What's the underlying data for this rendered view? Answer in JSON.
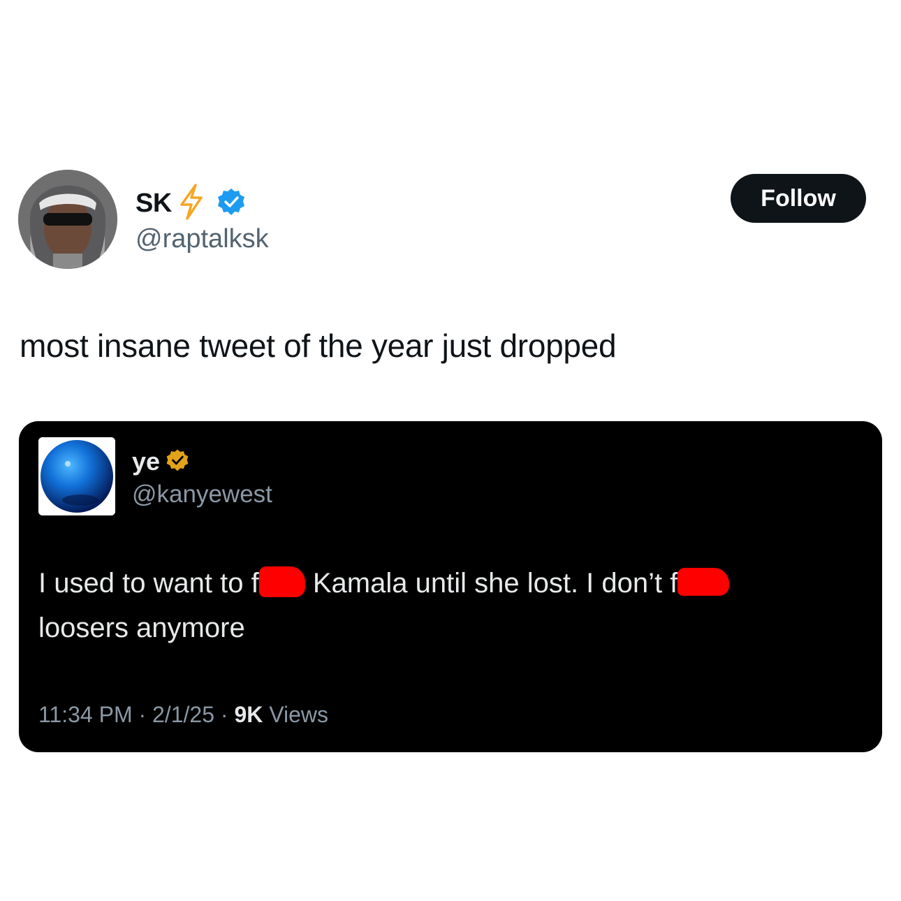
{
  "author": {
    "display_name": "SK",
    "handle": "@raptalksk",
    "follow_label": "Follow"
  },
  "post": {
    "text": "most insane tweet of the year just dropped"
  },
  "quoted": {
    "display_name": "ye",
    "handle": "@kanyewest",
    "text_part1": "I used to want to f",
    "text_part2": " Kamala until she lost. I don’t f",
    "text_part3": "loosers anymore",
    "time": "11:34 PM",
    "date": "2/1/25",
    "views_count": "9K",
    "views_label": "Views",
    "separator": "·"
  },
  "colors": {
    "accent_dark": "#0f1419",
    "verified_blue": "#1d9bf0",
    "verified_gold": "#e2a21a",
    "lightning": "#f5a623",
    "redaction": "#ff0000"
  }
}
